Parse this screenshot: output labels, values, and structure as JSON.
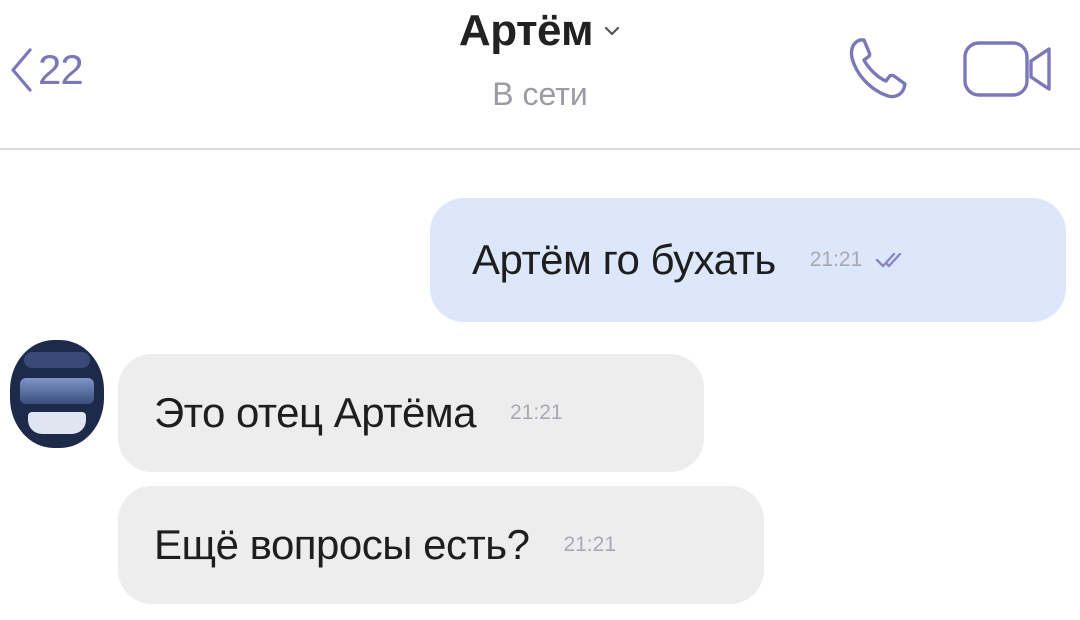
{
  "header": {
    "back_count": "22",
    "title": "Артём",
    "status": "В сети"
  },
  "messages": [
    {
      "direction": "outgoing",
      "text": "Артём го бухать",
      "time": "21:21",
      "read": true
    },
    {
      "direction": "incoming",
      "text": "Это отец Артёма",
      "time": "21:21"
    },
    {
      "direction": "incoming",
      "text": "Ещё вопросы есть?",
      "time": "21:21"
    }
  ],
  "colors": {
    "accent": "#7a78b8",
    "outgoing_bubble": "#dce7fb",
    "incoming_bubble": "#ededee",
    "title": "#222222",
    "secondary_text": "#9a9ba3"
  },
  "icons": {
    "back": "chevron-left-icon",
    "title_dropdown": "chevron-down-icon",
    "call": "phone-icon",
    "video": "video-camera-icon",
    "read_status": "double-check-icon"
  }
}
